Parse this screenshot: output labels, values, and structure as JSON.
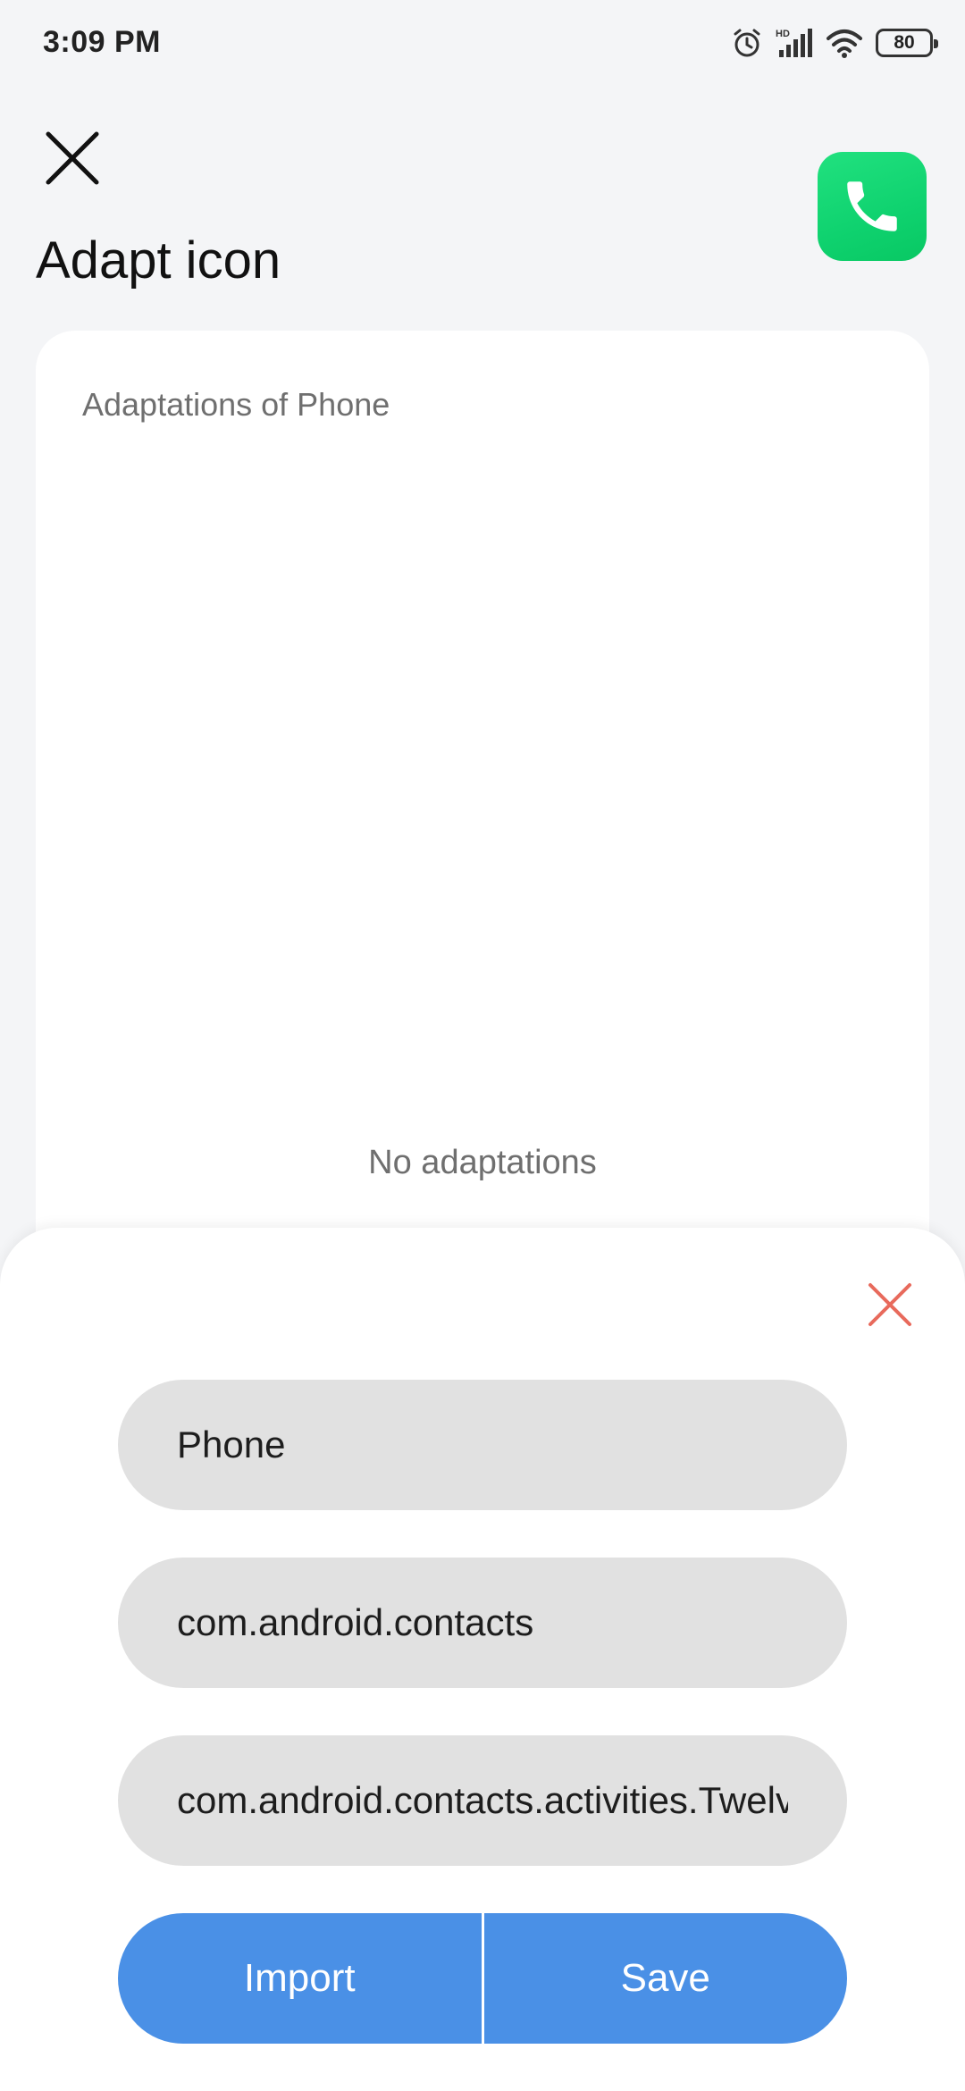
{
  "status_bar": {
    "time": "3:09 PM",
    "network_label": "HD",
    "battery": "80"
  },
  "header": {
    "title": "Adapt icon"
  },
  "card": {
    "label": "Adaptations of Phone",
    "empty_text": "No adaptations"
  },
  "sheet": {
    "name_value": "Phone",
    "package_value": "com.android.contacts",
    "activity_value": "com.android.contacts.activities.TwelveKeyDialer",
    "import_label": "Import",
    "save_label": "Save"
  },
  "colors": {
    "accent": "#4a90e6",
    "app_icon": "#1bd877",
    "sheet_close": "#e86a5c"
  },
  "icons": {
    "close": "close-icon",
    "app": "phone-icon"
  }
}
